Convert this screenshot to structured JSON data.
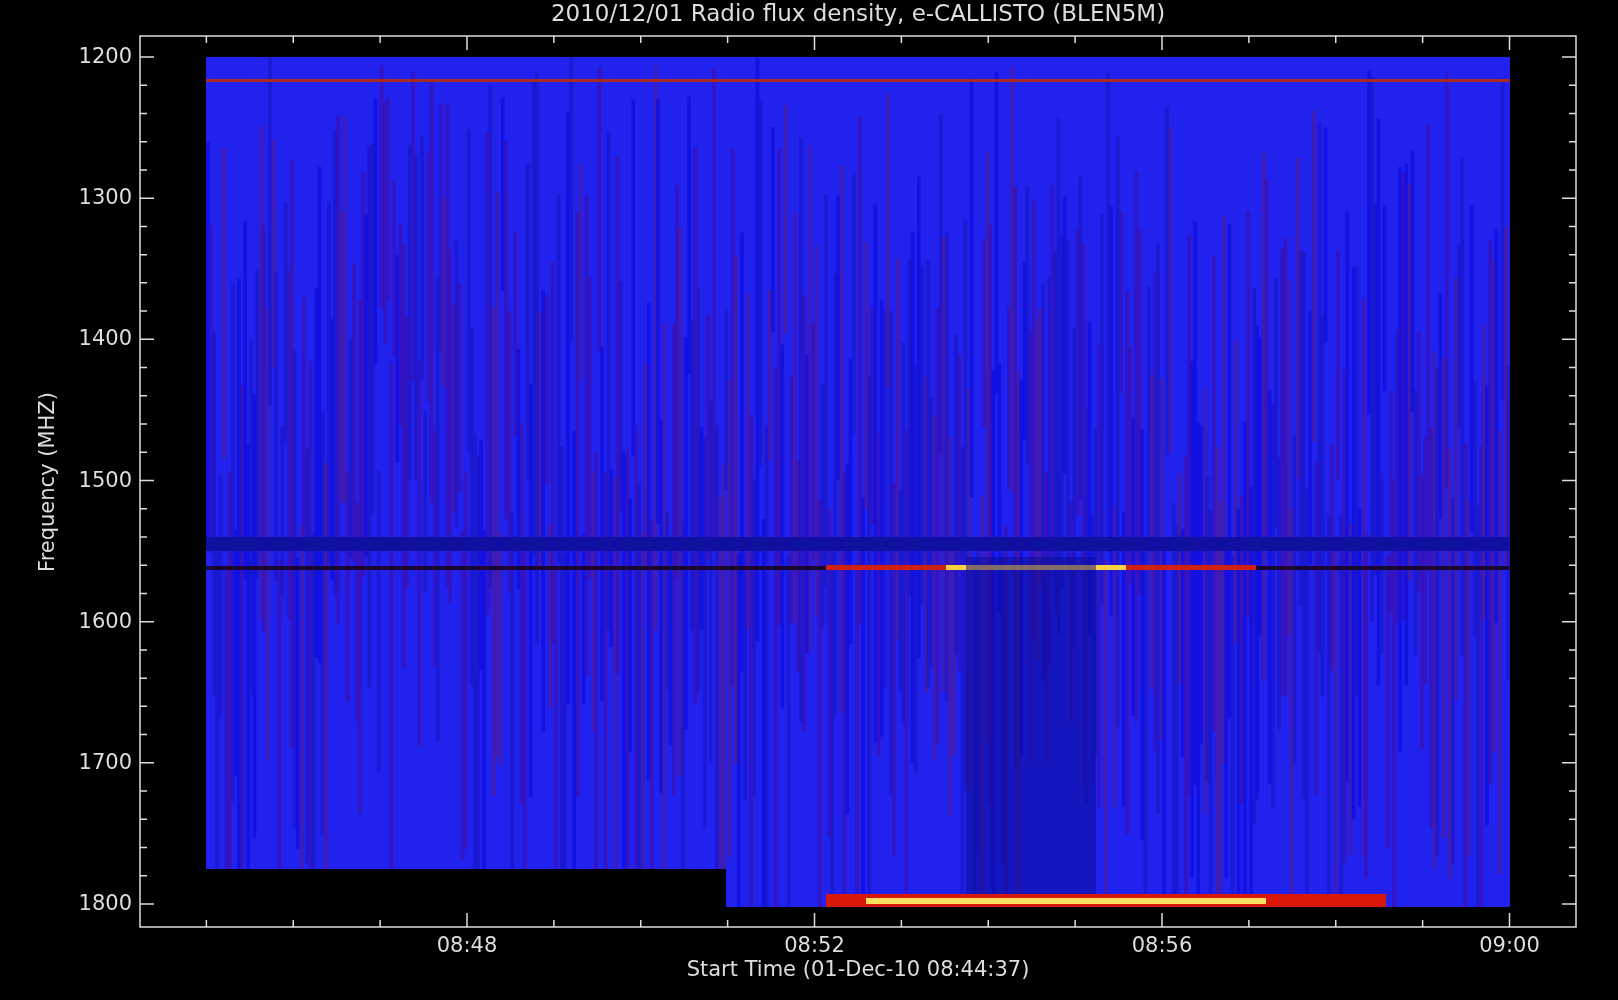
{
  "title": "2010/12/01  Radio flux density, e-CALLISTO (BLEN5M)",
  "xlabel": "Start Time (01-Dec-10 08:44:37)",
  "ylabel": "Frequency (MHZ)",
  "yticks": [
    "1200",
    "1300",
    "1400",
    "1500",
    "1600",
    "1700",
    "1800"
  ],
  "xticks": [
    "08:48",
    "08:52",
    "08:56",
    "09:00"
  ]
}
